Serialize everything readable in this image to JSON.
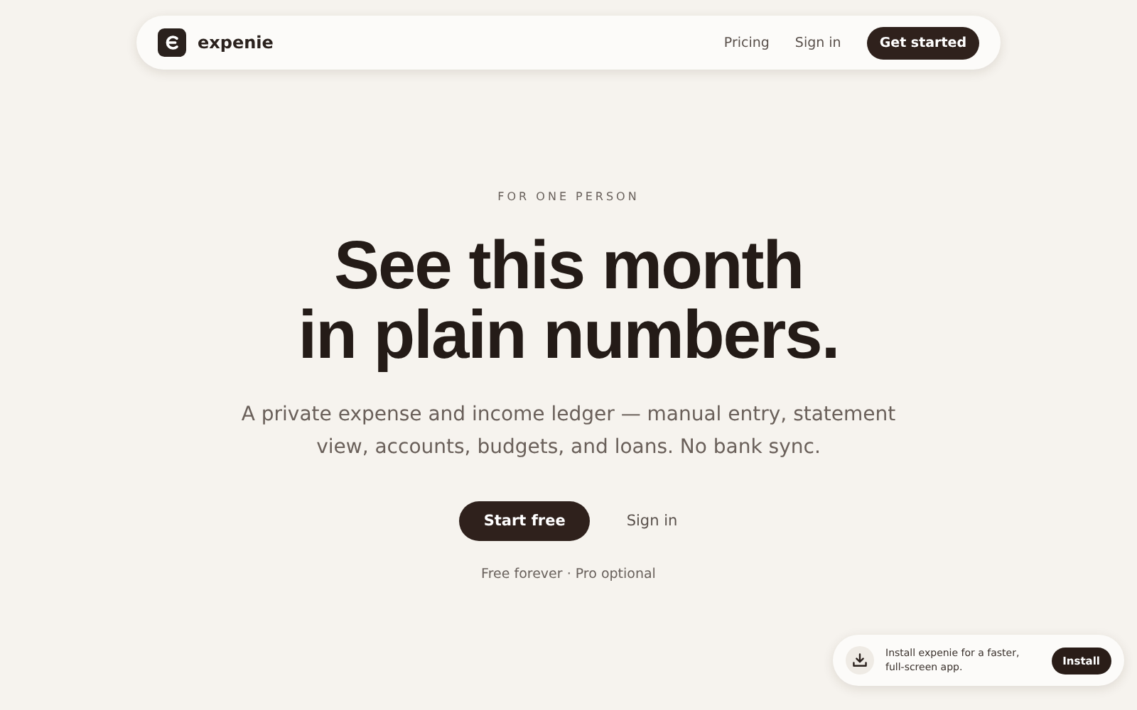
{
  "nav": {
    "brand": "expenie",
    "links": [
      "Pricing",
      "Sign in"
    ],
    "cta": "Get started"
  },
  "hero": {
    "eyebrow": "FOR ONE PERSON",
    "headline_lines": [
      "See this month",
      "in plain numbers."
    ],
    "subtitle": "A private expense and income ledger — manual entry, statement view, accounts, budgets, and loans. No bank sync.",
    "primary_button": "Start free",
    "secondary_link": "Sign in",
    "note": "Free forever · Pro optional"
  },
  "install_toast": {
    "message": "Install expenie for a faster, full-screen app.",
    "button": "Install"
  }
}
